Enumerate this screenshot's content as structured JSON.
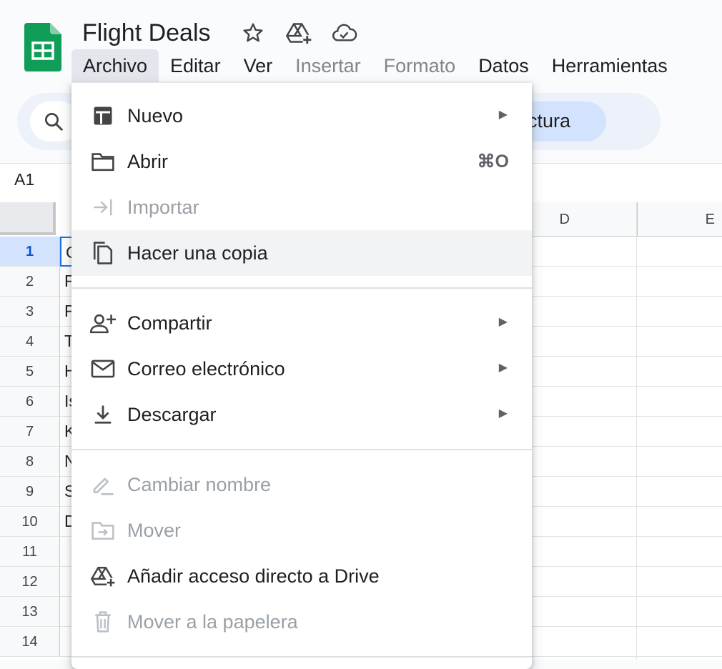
{
  "document": {
    "title": "Flight Deals"
  },
  "menubar": {
    "items": [
      {
        "label": "Archivo",
        "state": "active"
      },
      {
        "label": "Editar",
        "state": "normal"
      },
      {
        "label": "Ver",
        "state": "normal"
      },
      {
        "label": "Insertar",
        "state": "disabled"
      },
      {
        "label": "Formato",
        "state": "disabled"
      },
      {
        "label": "Datos",
        "state": "normal"
      },
      {
        "label": "Herramientas",
        "state": "normal"
      }
    ]
  },
  "toolbar": {
    "pill_text": "ctura"
  },
  "name_box": {
    "value": "A1"
  },
  "grid": {
    "columns": [
      "D",
      "E"
    ],
    "rows": [
      "1",
      "2",
      "3",
      "4",
      "5",
      "6",
      "7",
      "8",
      "9",
      "10",
      "11",
      "12",
      "13",
      "14"
    ],
    "selected_row": "1",
    "col_a_visible": [
      "C",
      "F",
      "F",
      "T",
      "H",
      "Is",
      "K",
      "N",
      "S",
      "D",
      "",
      "",
      "",
      ""
    ]
  },
  "file_menu": {
    "items": [
      {
        "label": "Nuevo",
        "icon": "new-sheet-icon",
        "submenu": true,
        "disabled": false
      },
      {
        "label": "Abrir",
        "icon": "folder-icon",
        "shortcut": "⌘O",
        "disabled": false
      },
      {
        "label": "Importar",
        "icon": "import-icon",
        "disabled": true
      },
      {
        "label": "Hacer una copia",
        "icon": "copy-icon",
        "disabled": false,
        "highlighted": true
      },
      {
        "label": "Compartir",
        "icon": "add-person-icon",
        "submenu": true,
        "disabled": false
      },
      {
        "label": "Correo electrónico",
        "icon": "mail-icon",
        "submenu": true,
        "disabled": false
      },
      {
        "label": "Descargar",
        "icon": "download-icon",
        "submenu": true,
        "disabled": false
      },
      {
        "label": "Cambiar nombre",
        "icon": "rename-icon",
        "disabled": true
      },
      {
        "label": "Mover",
        "icon": "move-folder-icon",
        "disabled": true
      },
      {
        "label": "Añadir acceso directo a Drive",
        "icon": "drive-shortcut-icon",
        "disabled": false
      },
      {
        "label": "Mover a la papelera",
        "icon": "trash-icon",
        "disabled": true
      }
    ]
  },
  "colors": {
    "sheets_green": "#0f9d58",
    "selection_blue": "#1a73e8",
    "menu_hover": "#f1f3f4"
  }
}
